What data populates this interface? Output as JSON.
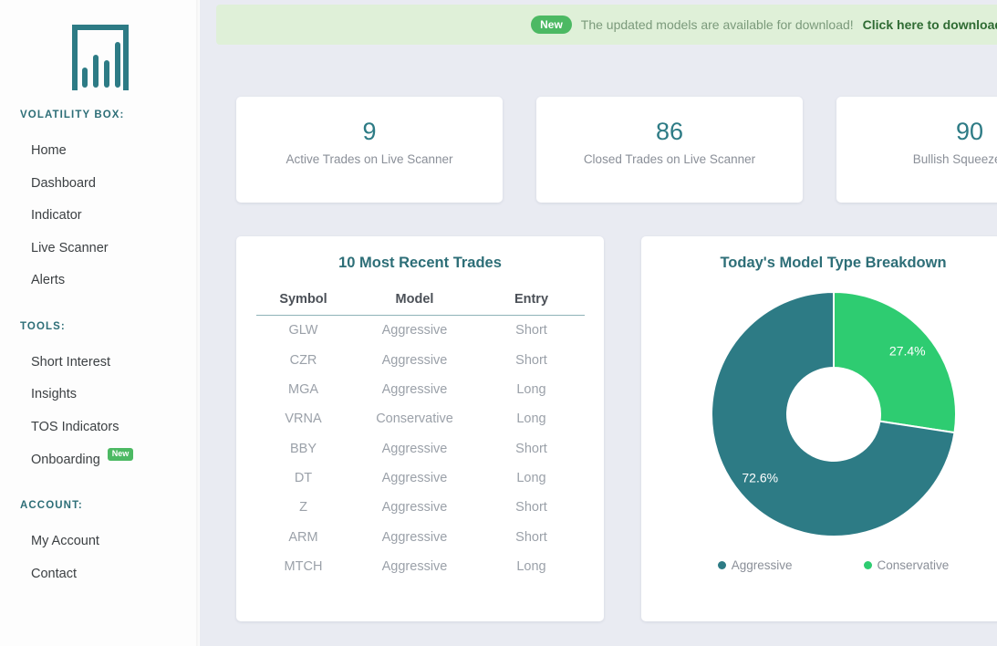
{
  "sidebar": {
    "logo_name": "bar-chart-logo",
    "groups": [
      {
        "title": "VOLATILITY BOX:",
        "items": [
          {
            "label": "Home"
          },
          {
            "label": "Dashboard"
          },
          {
            "label": "Indicator"
          },
          {
            "label": "Live Scanner"
          },
          {
            "label": "Alerts"
          }
        ]
      },
      {
        "title": "TOOLS:",
        "items": [
          {
            "label": "Short Interest"
          },
          {
            "label": "Insights"
          },
          {
            "label": "TOS Indicators"
          },
          {
            "label": "Onboarding",
            "badge": "New"
          }
        ]
      },
      {
        "title": "ACCOUNT:",
        "items": [
          {
            "label": "My Account"
          },
          {
            "label": "Contact"
          }
        ]
      }
    ]
  },
  "banner": {
    "badge": "New",
    "text": "The updated models are available for download!",
    "link": "Click here to download updated Vol",
    "bg_color": "#dff0d8",
    "badge_color": "#4cb963"
  },
  "stats": [
    {
      "value": "9",
      "label": "Active Trades on Live Scanner"
    },
    {
      "value": "86",
      "label": "Closed Trades on Live Scanner"
    },
    {
      "value": "90",
      "label": "Bullish Squeeze with"
    }
  ],
  "trades_panel": {
    "title": "10 Most Recent Trades",
    "columns": [
      "Symbol",
      "Model",
      "Entry"
    ],
    "rows": [
      [
        "GLW",
        "Aggressive",
        "Short"
      ],
      [
        "CZR",
        "Aggressive",
        "Short"
      ],
      [
        "MGA",
        "Aggressive",
        "Long"
      ],
      [
        "VRNA",
        "Conservative",
        "Long"
      ],
      [
        "BBY",
        "Aggressive",
        "Short"
      ],
      [
        "DT",
        "Aggressive",
        "Long"
      ],
      [
        "Z",
        "Aggressive",
        "Short"
      ],
      [
        "ARM",
        "Aggressive",
        "Short"
      ],
      [
        "MTCH",
        "Aggressive",
        "Long"
      ]
    ]
  },
  "donut_panel": {
    "title": "Today's Model Type Breakdown"
  },
  "chart_data": {
    "type": "pie",
    "title": "Today's Model Type Breakdown",
    "donut": true,
    "start_angle_deg": 0,
    "direction": "clockwise",
    "categories": [
      "Conservative",
      "Aggressive"
    ],
    "values": [
      27.4,
      72.6
    ],
    "labels": [
      "27.4%",
      "72.6%"
    ],
    "colors": [
      "#2ecc71",
      "#2d7b85"
    ],
    "legend": [
      {
        "name": "Aggressive",
        "color": "#2d7b85"
      },
      {
        "name": "Conservative",
        "color": "#2ecc71"
      }
    ],
    "legend_position": "bottom",
    "xlabel": "",
    "ylabel": ""
  },
  "theme": {
    "page_bg": "#e9ebf2",
    "card_bg": "#ffffff",
    "brand_teal": "#2d7b85",
    "brand_green": "#2ecc71",
    "muted_text": "#8a8f98"
  }
}
